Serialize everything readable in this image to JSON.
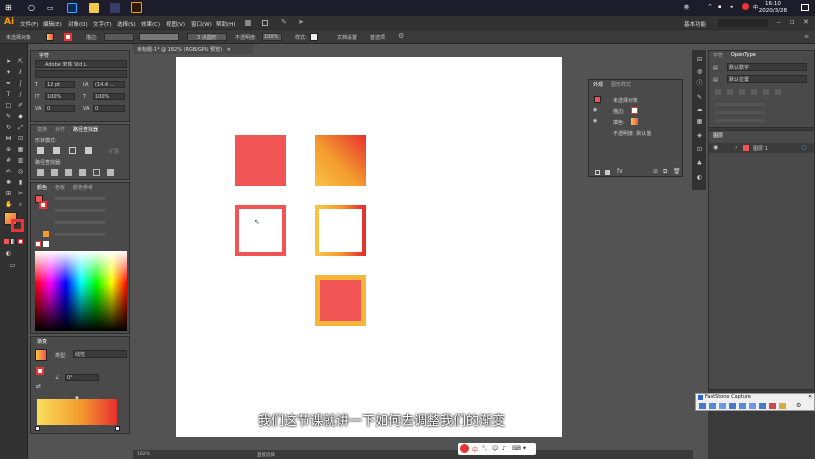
{
  "taskbar": {
    "time": "16:10",
    "date": "2020/3/28"
  },
  "app": {
    "logo": "Ai",
    "menus": [
      "文件(F)",
      "编辑(E)",
      "对象(O)",
      "文字(T)",
      "选择(S)",
      "效果(C)",
      "视图(V)",
      "窗口(W)",
      "帮助(H)"
    ],
    "workspace": "基本功能"
  },
  "control_bar": {
    "selection_label": "未选择对象",
    "stroke_label": "描边:",
    "brush_label": "3 点圆形",
    "opacity_label": "不透明度:",
    "opacity_value": "100%",
    "style_label": "样式:",
    "doc_setup": "文档设置",
    "preferences": "首选项"
  },
  "document": {
    "tab_title": "未标题-1* @ 182% (RGB/GPU 预览)",
    "zoom": "182%"
  },
  "character_panel": {
    "title": "字符",
    "font_family": "Adobe 宋体 Std L",
    "font_size": "12 pt",
    "leading": "(14.4 ...",
    "tracking": "100%",
    "scale": "100%",
    "kerning": "0",
    "baseline": "0"
  },
  "pathfinder_panel": {
    "tabs": [
      "变换",
      "对齐",
      "路径查找器"
    ],
    "shape_modes_label": "形状模式:",
    "pathfinders_label": "路径查找器:",
    "expand_label": "扩展"
  },
  "color_panel": {
    "tabs": [
      "颜色",
      "色板",
      "颜色参考"
    ]
  },
  "gradient_panel": {
    "title": "渐变",
    "type_label": "类型:",
    "type_value": "线性",
    "angle_value": "0°"
  },
  "appearance_panel": {
    "tabs": [
      "外观",
      "图形样式"
    ],
    "object_label": "未选择对象",
    "stroke_label": "描边:",
    "fill_label": "填色:",
    "opacity_label": "不透明度: 默认值"
  },
  "right_dock": {
    "tabs": [
      "字符",
      "OpenType"
    ],
    "row1": "默认数字",
    "row2": "默认位置",
    "layers_title": "图层",
    "layer_name": "图层 1",
    "layer_count": "1 个图层"
  },
  "faststone": {
    "title": "FastStone Capture"
  },
  "subtitle": "我们这节课就讲一下如何去调整我们的渐变",
  "status_bar": {
    "zoom": "182%",
    "tool": "直接选择"
  },
  "colors": {
    "red": "#f05454",
    "orange": "#f39a2e",
    "yellow": "#f8c445",
    "artboard": "#ffffff",
    "ui_dark": "#323232",
    "ui_panel": "#4a4a4a"
  }
}
